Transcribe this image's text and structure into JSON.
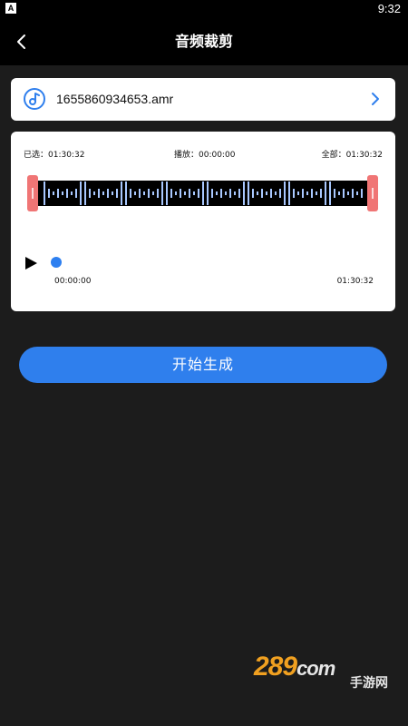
{
  "status_bar": {
    "app_badge": "A",
    "time": "9:32"
  },
  "header": {
    "title": "音频裁剪",
    "back_icon": "chevron-left-icon"
  },
  "file": {
    "name": "1655860934653.amr",
    "icon": "music-note-icon",
    "open_icon": "chevron-right-icon"
  },
  "editor": {
    "selected_label": "已选：01:30:32",
    "playing_label": "播放：00:00:00",
    "total_label": "全部：01:30:32",
    "play_position": 0,
    "time_start": "00:00:00",
    "time_end": "01:30:32"
  },
  "actions": {
    "generate_label": "开始生成"
  },
  "watermark": {
    "brand": "289",
    "domain": "com",
    "subtitle": "手游网"
  },
  "colors": {
    "background": "#1c1c1c",
    "accent": "#2f7fed",
    "trim_handle": "#f07575",
    "wave_bar": "#a9c8ff"
  }
}
